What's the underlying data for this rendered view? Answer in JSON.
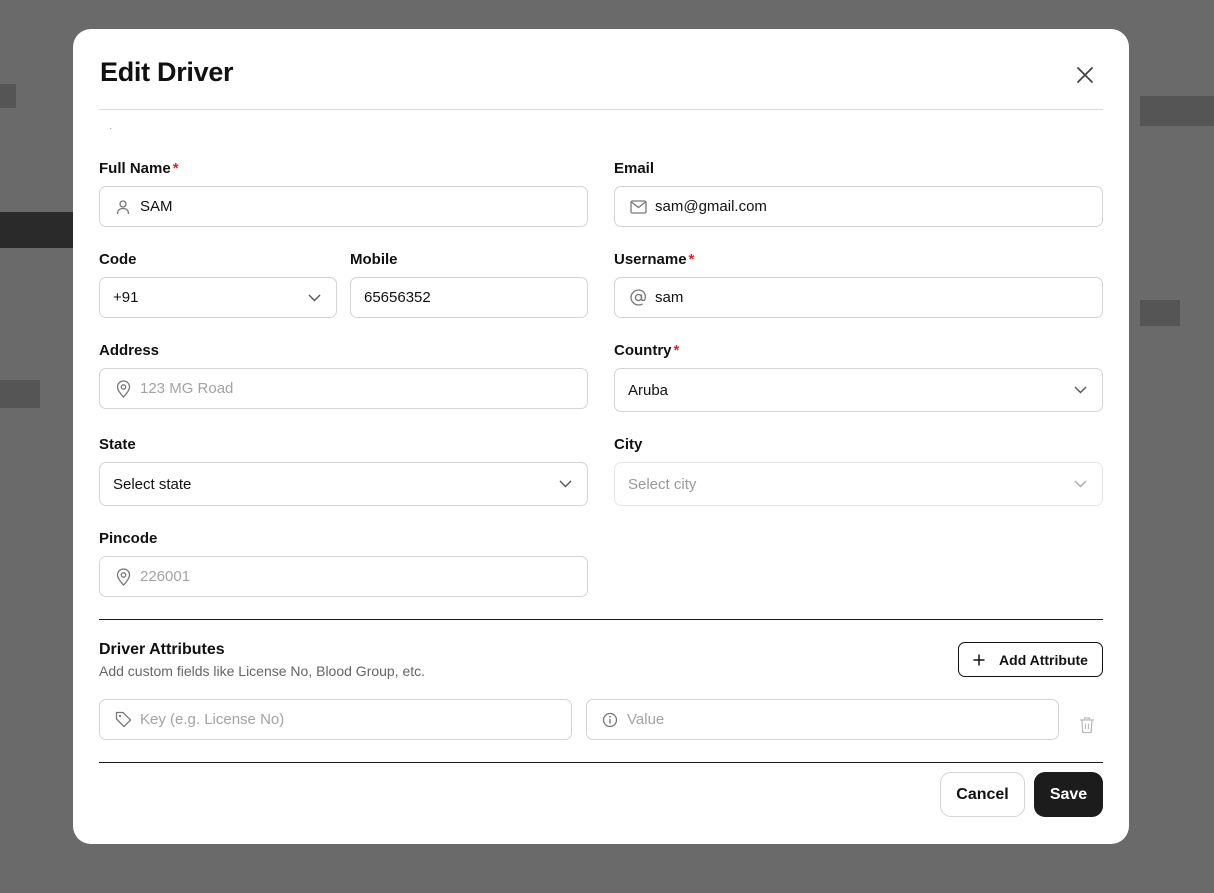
{
  "modal": {
    "title": "Edit Driver"
  },
  "form": {
    "full_name": {
      "label": "Full Name",
      "required_mark": "*",
      "value": "SAM"
    },
    "email": {
      "label": "Email",
      "value": "sam@gmail.com"
    },
    "code": {
      "label": "Code",
      "value": "+91"
    },
    "mobile": {
      "label": "Mobile",
      "value": "65656352"
    },
    "username": {
      "label": "Username",
      "required_mark": "*",
      "value": "sam"
    },
    "address": {
      "label": "Address",
      "value": "",
      "placeholder": "123 MG Road"
    },
    "country": {
      "label": "Country",
      "required_mark": "*",
      "value": "Aruba"
    },
    "state": {
      "label": "State",
      "value": "Select state"
    },
    "city": {
      "label": "City",
      "value": "Select city"
    },
    "pincode": {
      "label": "Pincode",
      "value": "",
      "placeholder": "226001"
    }
  },
  "attributes": {
    "title": "Driver Attributes",
    "subtitle": "Add custom fields like License No, Blood Group, etc.",
    "add_label": "Add Attribute",
    "rows": [
      {
        "key": "",
        "key_placeholder": "Key (e.g. License No)",
        "value": "",
        "value_placeholder": "Value"
      }
    ]
  },
  "footer": {
    "cancel_label": "Cancel",
    "save_label": "Save"
  },
  "icons": {
    "close": "close-icon",
    "user": "user-icon",
    "mail": "mail-icon",
    "at": "at-icon",
    "map_pin": "map-pin-icon",
    "chevron": "chevron-down-icon",
    "tag": "tag-icon",
    "info": "info-icon",
    "trash": "trash-icon",
    "plus": "plus-icon"
  },
  "colors": {
    "overlay": "#6a6a6a",
    "required": "#e02424",
    "primary_button": "#1c1c1c"
  }
}
